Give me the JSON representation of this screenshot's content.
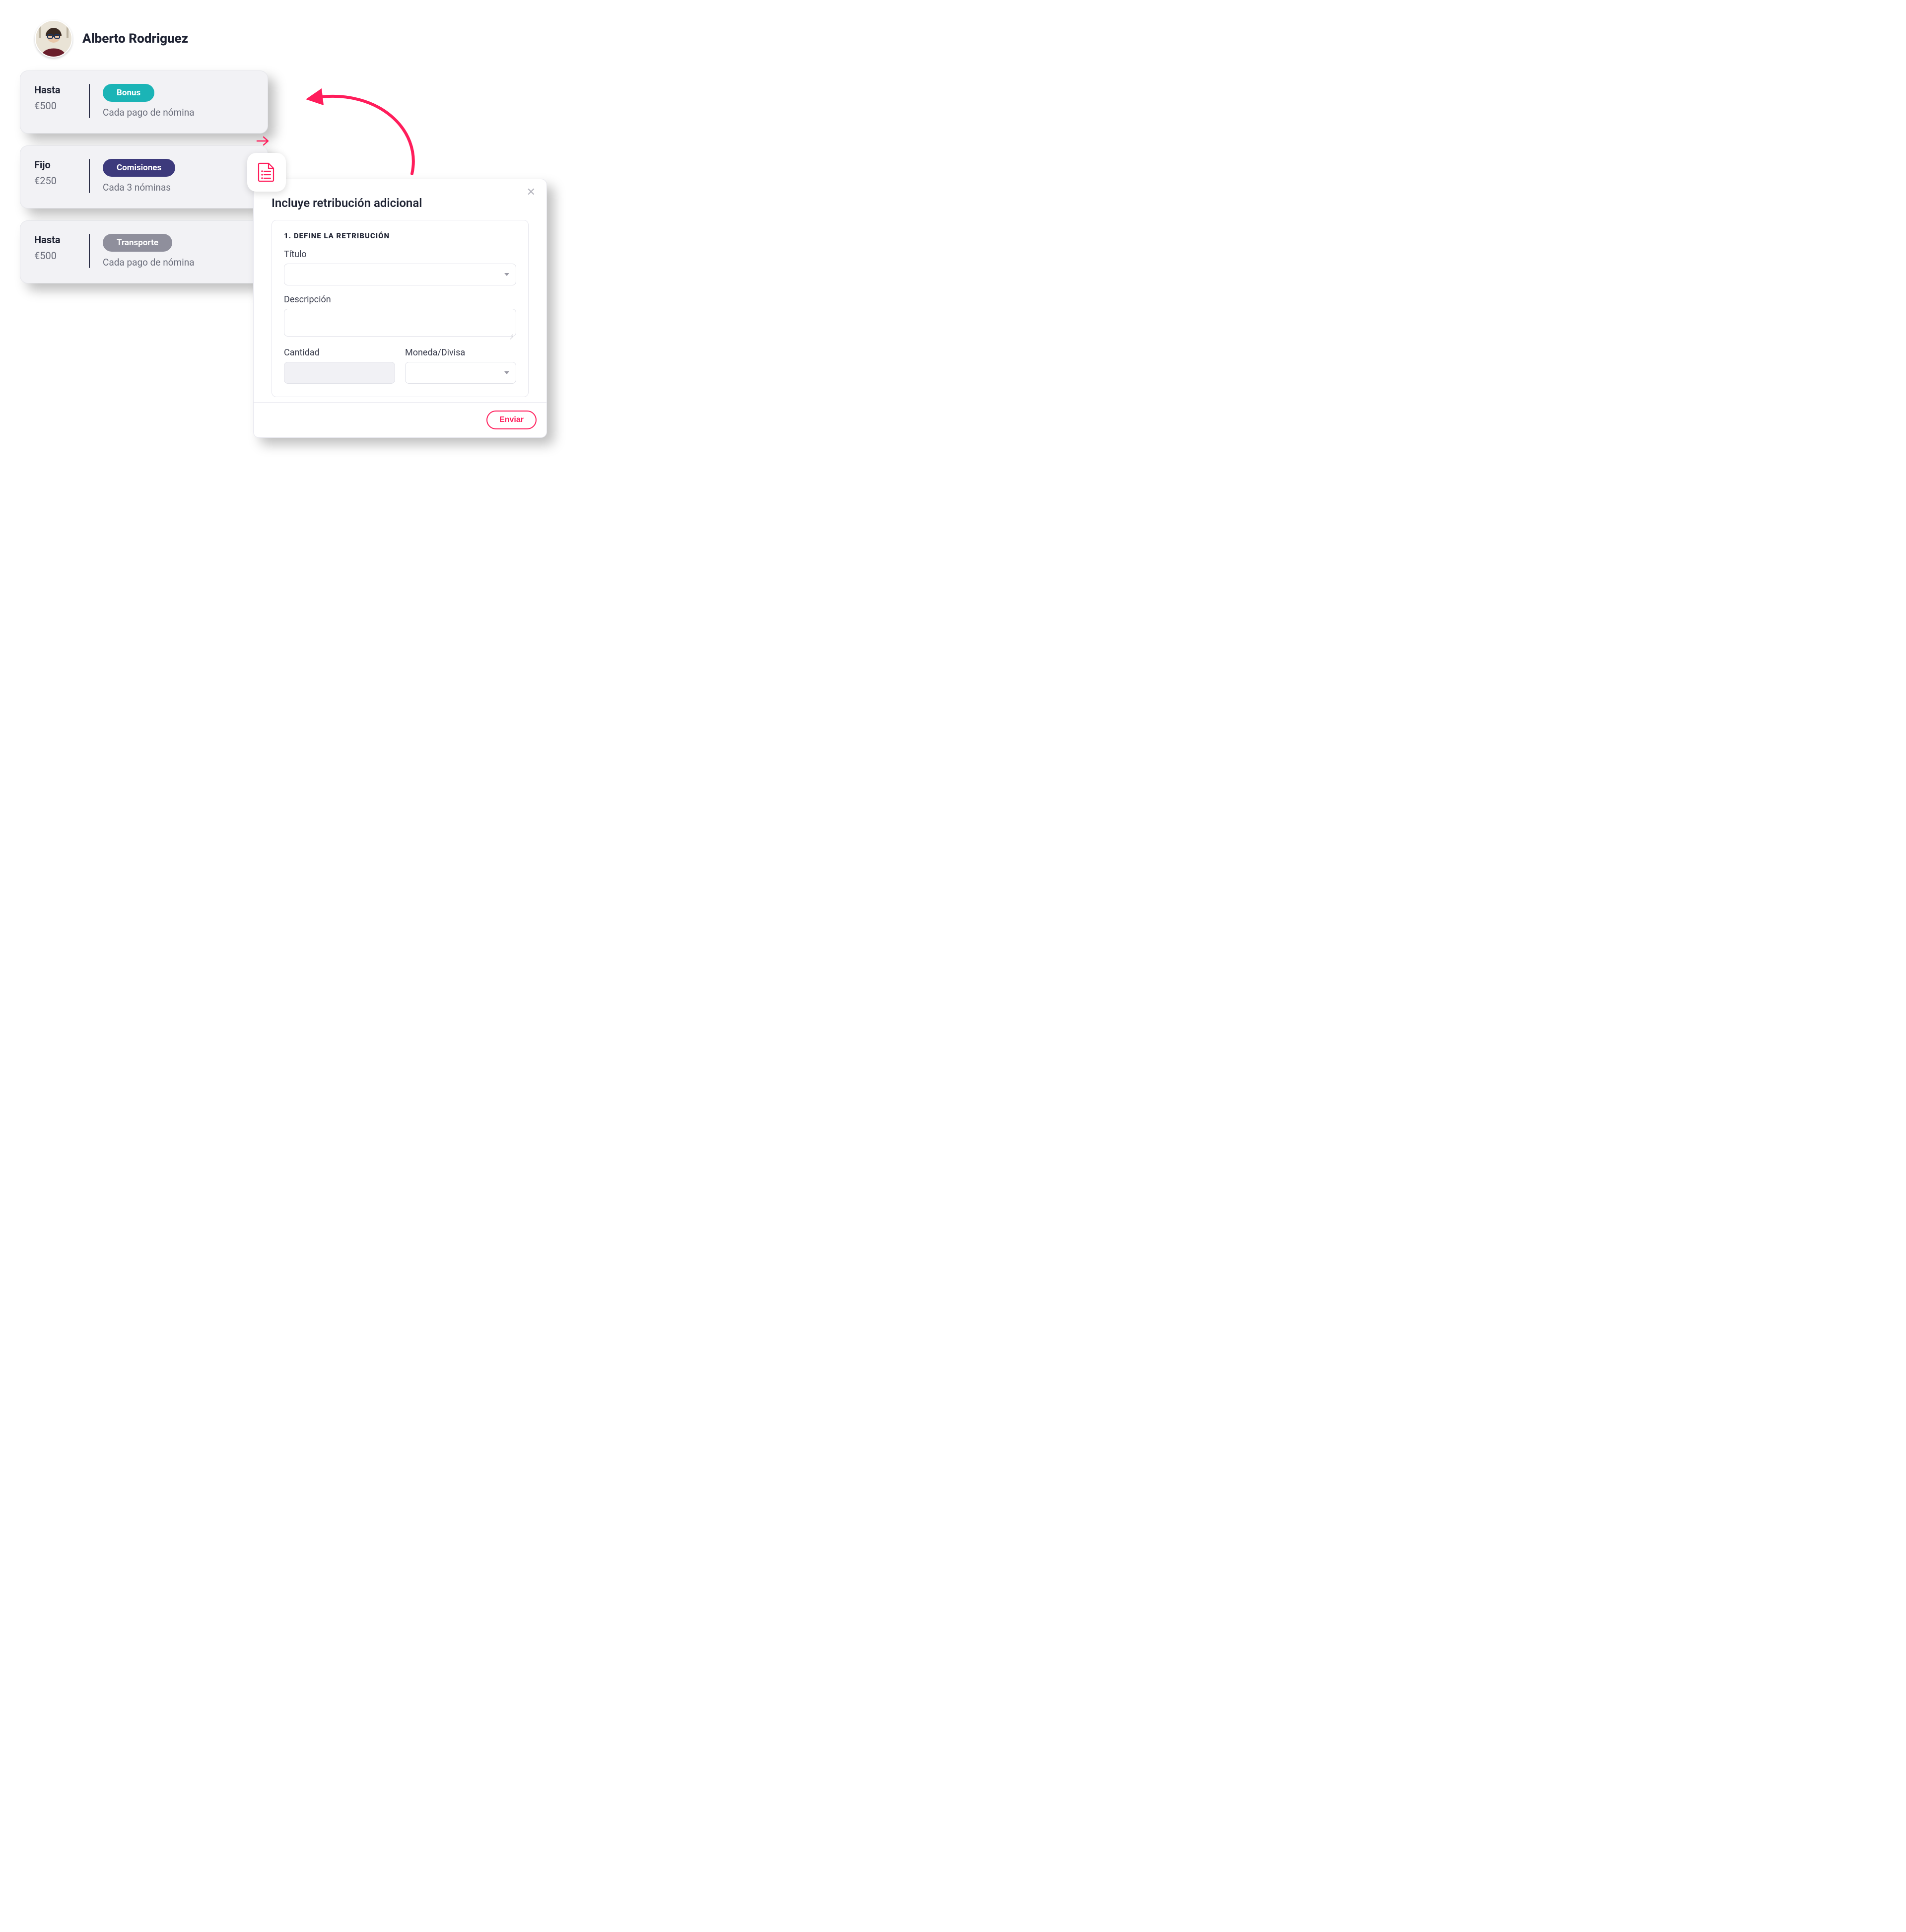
{
  "profile": {
    "name": "Alberto Rodriguez"
  },
  "cards": [
    {
      "type": "Hasta",
      "amount": "€500",
      "chip": "Bonus",
      "chip_style": "teal",
      "freq": "Cada pago de nómina"
    },
    {
      "type": "Fijo",
      "amount": "€250",
      "chip": "Comisiones",
      "chip_style": "indigo",
      "freq": "Cada 3 nóminas"
    },
    {
      "type": "Hasta",
      "amount": "€500",
      "chip": "Transporte",
      "chip_style": "slate",
      "freq": "Cada pago de nómina"
    }
  ],
  "modal": {
    "title": "Incluye retribución adicional",
    "step_label": "1. DEFINE LA RETRIBUCIÓN",
    "fields": {
      "title_label": "Título",
      "title_value": "",
      "desc_label": "Descripción",
      "desc_value": "",
      "amount_label": "Cantidad",
      "amount_value": "",
      "currency_label": "Moneda/Divisa",
      "currency_value": ""
    },
    "submit": "Enviar"
  },
  "colors": {
    "brand_pink": "#ff1d5b",
    "teal": "#1bb4b6",
    "indigo": "#3d3a7c",
    "slate": "#8f8f9c"
  },
  "icons": {
    "document": "document-list-icon",
    "close": "close-icon",
    "arrow_right": "arrow-right-icon",
    "flow_arrow": "flow-arrow-icon",
    "chevron_down": "chevron-down-icon"
  }
}
